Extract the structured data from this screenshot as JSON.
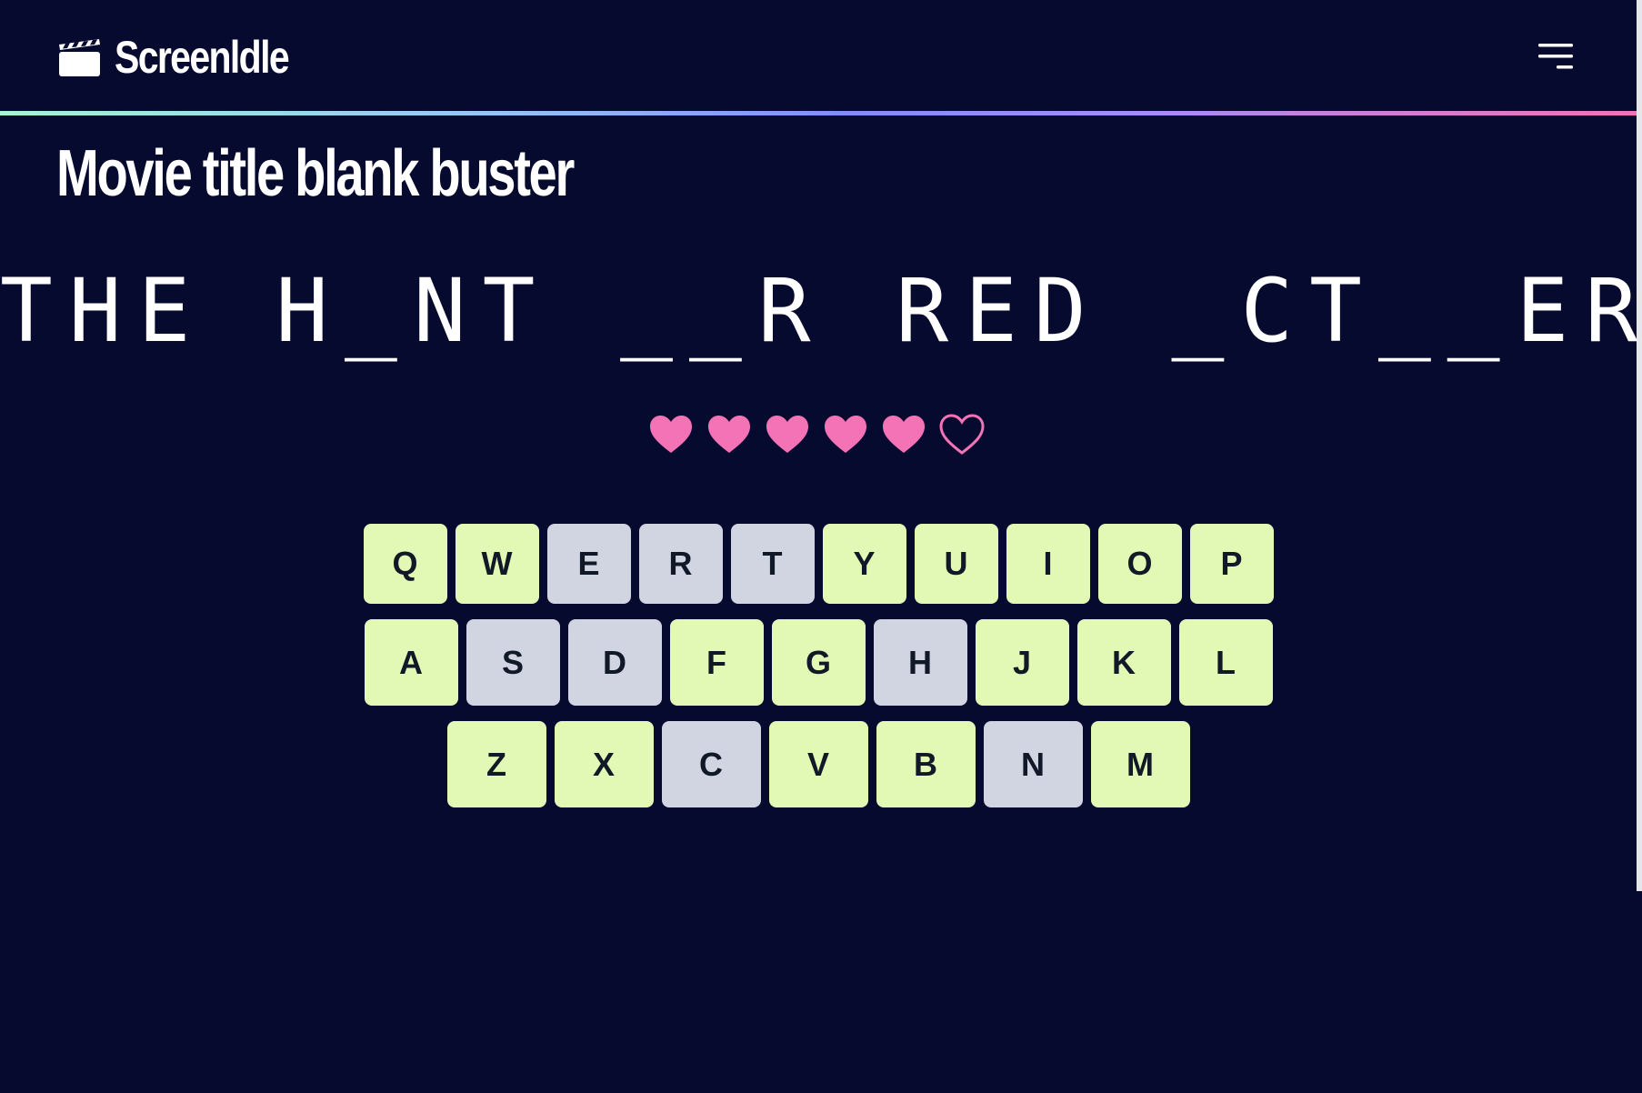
{
  "header": {
    "brand": "Screenldle",
    "logo_icon": "clapperboard-icon",
    "menu_icon": "hamburger-menu-icon"
  },
  "page": {
    "title": "Movie title blank buster"
  },
  "puzzle": {
    "display": "THE H_NT __R RED _CT__ER"
  },
  "lives": {
    "total": 6,
    "remaining": 5,
    "icon": "heart-icon",
    "color": "#f472b6"
  },
  "keyboard": {
    "rows": [
      [
        {
          "letter": "Q",
          "state": "unused"
        },
        {
          "letter": "W",
          "state": "unused"
        },
        {
          "letter": "E",
          "state": "used"
        },
        {
          "letter": "R",
          "state": "used"
        },
        {
          "letter": "T",
          "state": "used"
        },
        {
          "letter": "Y",
          "state": "unused"
        },
        {
          "letter": "U",
          "state": "unused"
        },
        {
          "letter": "I",
          "state": "unused"
        },
        {
          "letter": "O",
          "state": "unused"
        },
        {
          "letter": "P",
          "state": "unused"
        }
      ],
      [
        {
          "letter": "A",
          "state": "unused"
        },
        {
          "letter": "S",
          "state": "used"
        },
        {
          "letter": "D",
          "state": "used"
        },
        {
          "letter": "F",
          "state": "unused"
        },
        {
          "letter": "G",
          "state": "unused"
        },
        {
          "letter": "H",
          "state": "used"
        },
        {
          "letter": "J",
          "state": "unused"
        },
        {
          "letter": "K",
          "state": "unused"
        },
        {
          "letter": "L",
          "state": "unused"
        }
      ],
      [
        {
          "letter": "Z",
          "state": "unused"
        },
        {
          "letter": "X",
          "state": "unused"
        },
        {
          "letter": "C",
          "state": "used"
        },
        {
          "letter": "V",
          "state": "unused"
        },
        {
          "letter": "B",
          "state": "unused"
        },
        {
          "letter": "N",
          "state": "used"
        },
        {
          "letter": "M",
          "state": "unused"
        }
      ]
    ],
    "colors": {
      "unused": "#e2f8b5",
      "used": "#d1d5e2",
      "text": "#111827"
    }
  },
  "theme": {
    "background": "#070a2f",
    "accent_gradient": [
      "#a7f3d0",
      "#818cf8",
      "#f472b6"
    ]
  }
}
